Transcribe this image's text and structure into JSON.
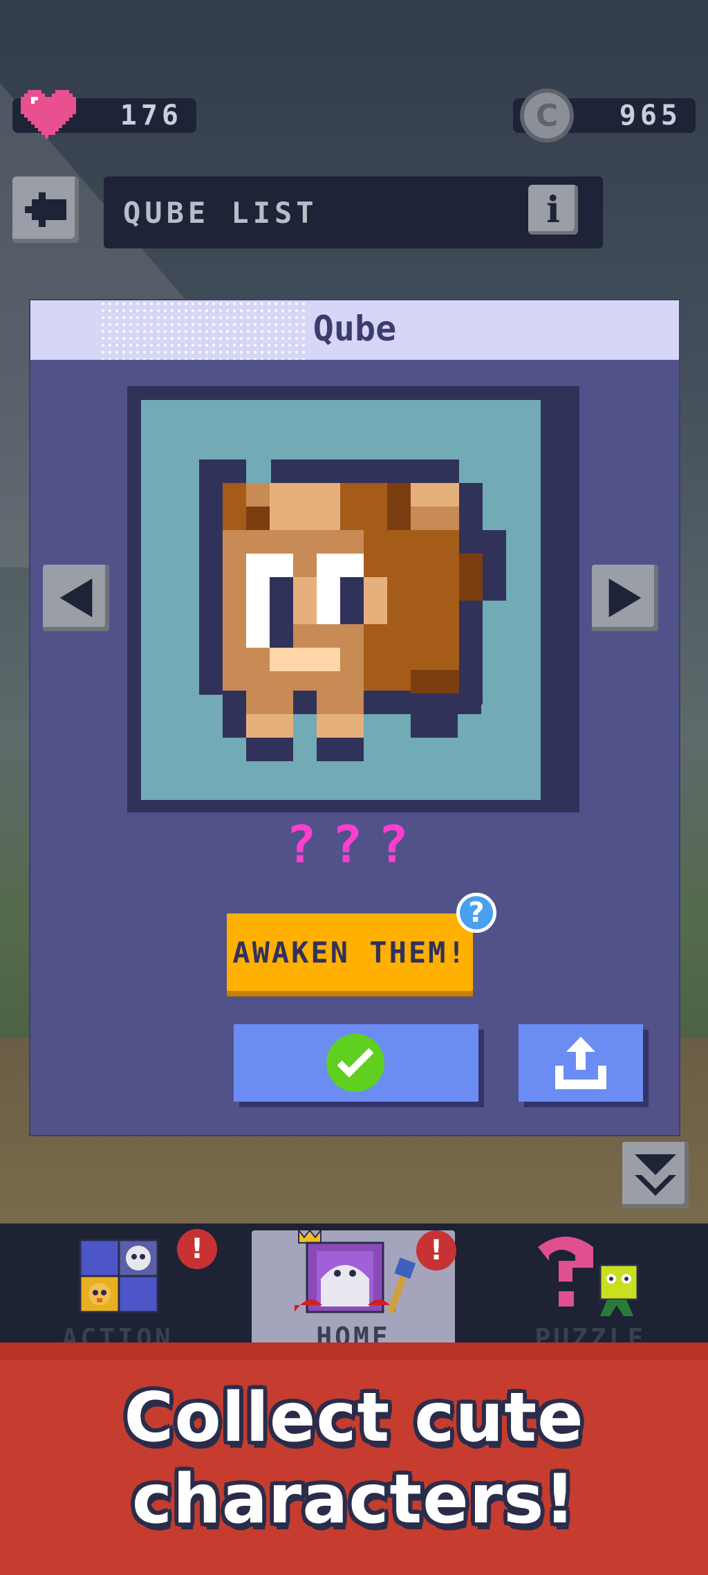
{
  "hud": {
    "hearts": "176",
    "coins": "965"
  },
  "header": {
    "title": "QUBE LIST"
  },
  "modal": {
    "title": "Qube",
    "character_name": "???",
    "awaken_label": "AWAKEN THEM!",
    "help_badge": "?"
  },
  "nav": {
    "items": [
      {
        "label": "ACTION",
        "badge": "!"
      },
      {
        "label": "HOME",
        "badge": "!"
      },
      {
        "label": "PUZZLE"
      }
    ]
  },
  "promo": {
    "line1": "Collect cute",
    "line2": "characters!"
  },
  "colors": {
    "panel": "#52528a",
    "accent_yellow": "#ffb000",
    "button_blue": "#6b8cf3",
    "check_green": "#5fcf20",
    "banner_red": "#c63d2f",
    "question_pink": "#ff3dcf"
  },
  "icons": [
    "heart-icon",
    "coin-icon",
    "back-arrow-icon",
    "info-icon",
    "prev-arrow-icon",
    "next-arrow-icon",
    "question-badge-icon",
    "checkmark-icon",
    "share-icon",
    "collapse-icon",
    "alert-icon"
  ]
}
